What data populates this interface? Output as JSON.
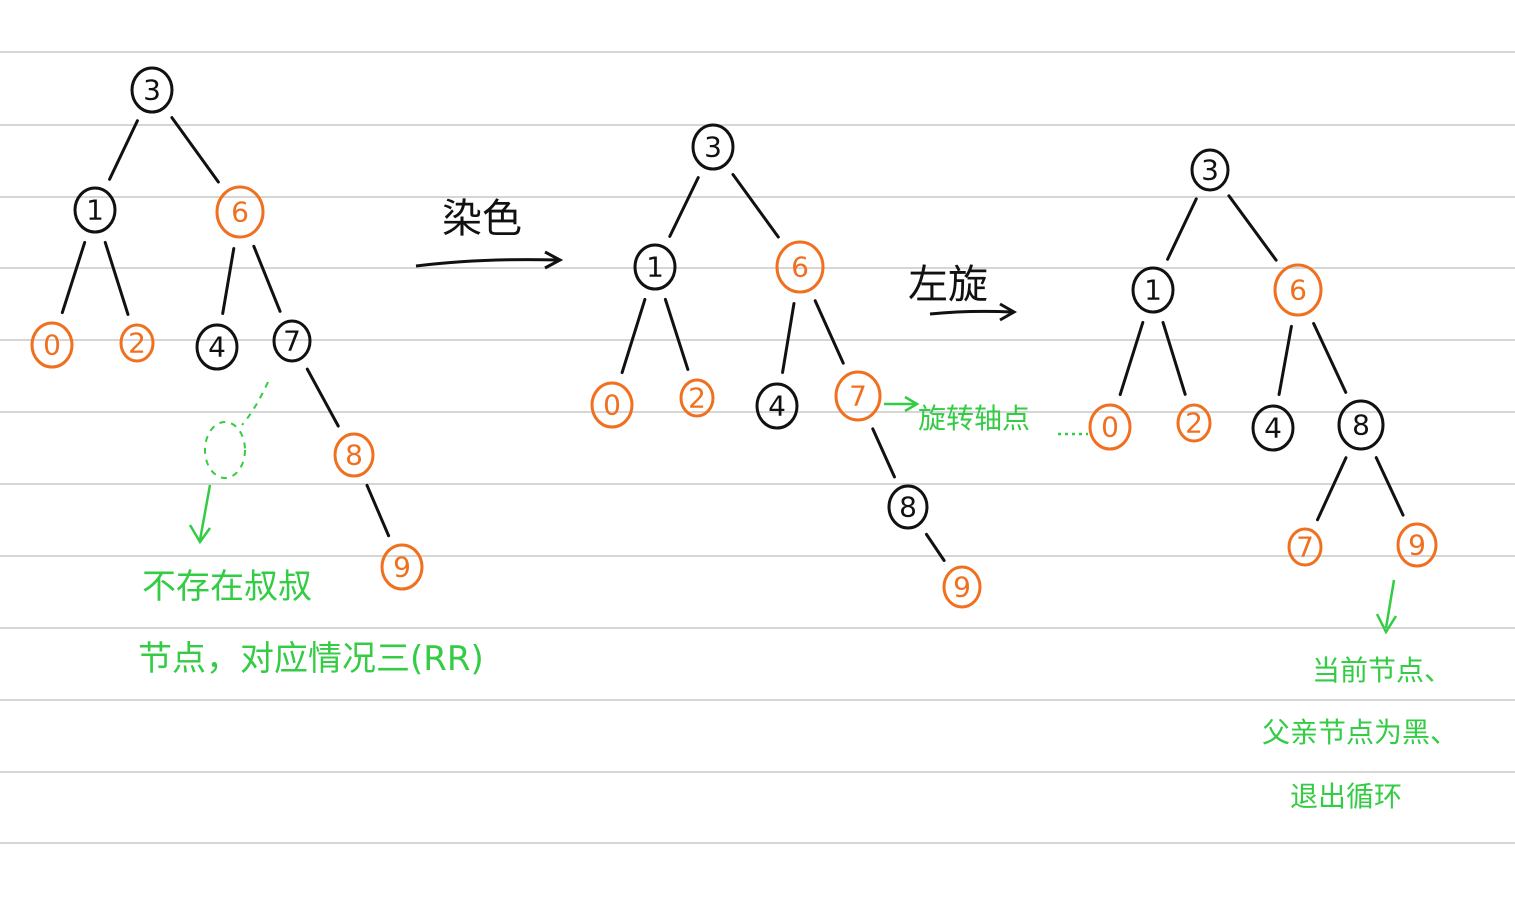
{
  "colors": {
    "black_node": "#111111",
    "red_node": "#f07020",
    "annotation": "#33cc44",
    "ruled_line": "#c8c8c8"
  },
  "labels": {
    "step1": "染色",
    "step2": "左旋"
  },
  "notes": {
    "no_uncle_line1": "不存在叔叔",
    "no_uncle_line2": "节点，对应情况三(RR)",
    "pivot": "旋转轴点",
    "exit_line1": "当前节点、",
    "exit_line2": "父亲节点为黑、",
    "exit_line3": "退出循环"
  },
  "trees": [
    {
      "name": "tree-before",
      "nodes": [
        {
          "key": "3",
          "color": "black"
        },
        {
          "key": "1",
          "color": "black"
        },
        {
          "key": "6",
          "color": "red"
        },
        {
          "key": "0",
          "color": "red"
        },
        {
          "key": "2",
          "color": "red"
        },
        {
          "key": "4",
          "color": "black"
        },
        {
          "key": "7",
          "color": "black"
        },
        {
          "key": "8",
          "color": "red"
        },
        {
          "key": "9",
          "color": "red"
        }
      ]
    },
    {
      "name": "tree-recolored",
      "nodes": [
        {
          "key": "3",
          "color": "black"
        },
        {
          "key": "1",
          "color": "black"
        },
        {
          "key": "6",
          "color": "red"
        },
        {
          "key": "0",
          "color": "red"
        },
        {
          "key": "2",
          "color": "red"
        },
        {
          "key": "4",
          "color": "black"
        },
        {
          "key": "7",
          "color": "red"
        },
        {
          "key": "8",
          "color": "black"
        },
        {
          "key": "9",
          "color": "red"
        }
      ]
    },
    {
      "name": "tree-rotated",
      "nodes": [
        {
          "key": "3",
          "color": "black"
        },
        {
          "key": "1",
          "color": "black"
        },
        {
          "key": "6",
          "color": "red"
        },
        {
          "key": "0",
          "color": "red"
        },
        {
          "key": "2",
          "color": "red"
        },
        {
          "key": "4",
          "color": "black"
        },
        {
          "key": "8",
          "color": "black"
        },
        {
          "key": "7",
          "color": "red"
        },
        {
          "key": "9",
          "color": "red"
        }
      ]
    }
  ]
}
